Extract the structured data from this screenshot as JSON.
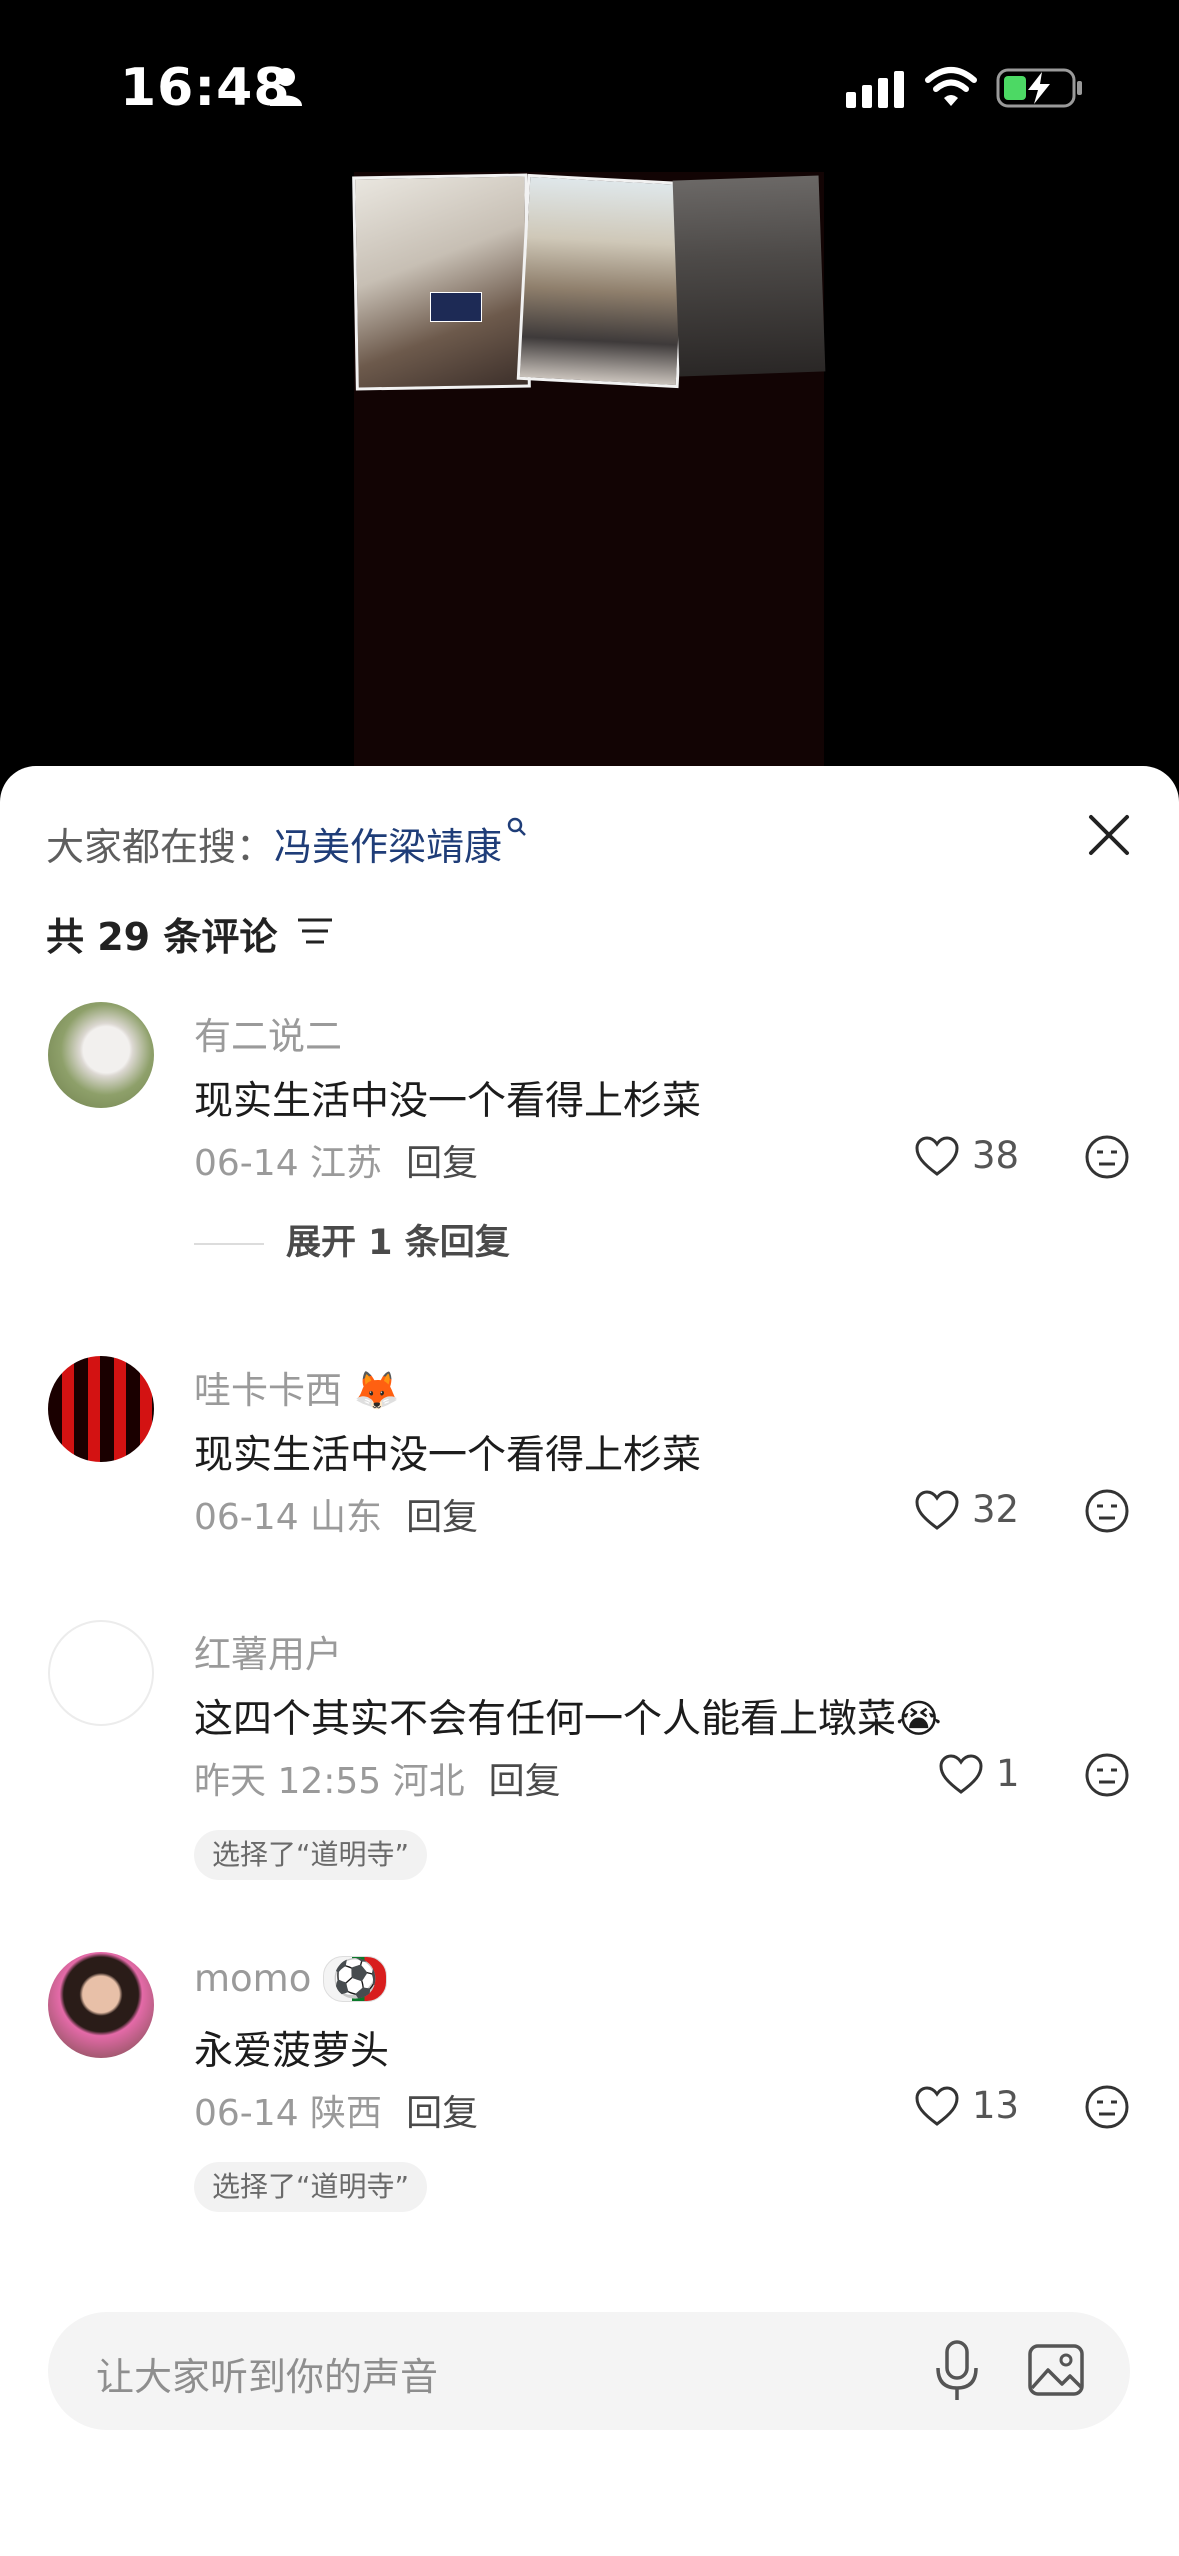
{
  "status_bar": {
    "time": "16:48"
  },
  "search_hint": {
    "prefix": "大家都在搜：",
    "query": "冯美作梁靖康"
  },
  "comments_header": {
    "count_label": "共 29 条评论"
  },
  "comments": [
    {
      "user": "有二说二",
      "text": "现实生活中没一个看得上杉菜",
      "meta": "06-14 江苏",
      "reply": "回复",
      "likes": "38",
      "expand": "展开 1 条回复"
    },
    {
      "user": "哇卡卡西",
      "user_emoji": "🦊",
      "text": "现实生活中没一个看得上杉菜",
      "meta": "06-14 山东",
      "reply": "回复",
      "likes": "32"
    },
    {
      "user": "红薯用户",
      "text": "这四个其实不会有任何一个人能看上墩菜",
      "text_emoji": "😭",
      "meta": "昨天 12:55 河北",
      "reply": "回复",
      "likes": "1",
      "tag": "选择了“道明寺”"
    },
    {
      "user": "momo",
      "user_emoji": "⚽",
      "text": "永爱菠萝头",
      "meta": "06-14 陕西",
      "reply": "回复",
      "likes": "13",
      "tag": "选择了“道明寺”"
    }
  ],
  "input": {
    "placeholder": "让大家听到你的声音"
  },
  "colors": {
    "accent_link": "#1f3d78",
    "sheet_bg": "#ffffff",
    "video_bg": "#120404"
  }
}
